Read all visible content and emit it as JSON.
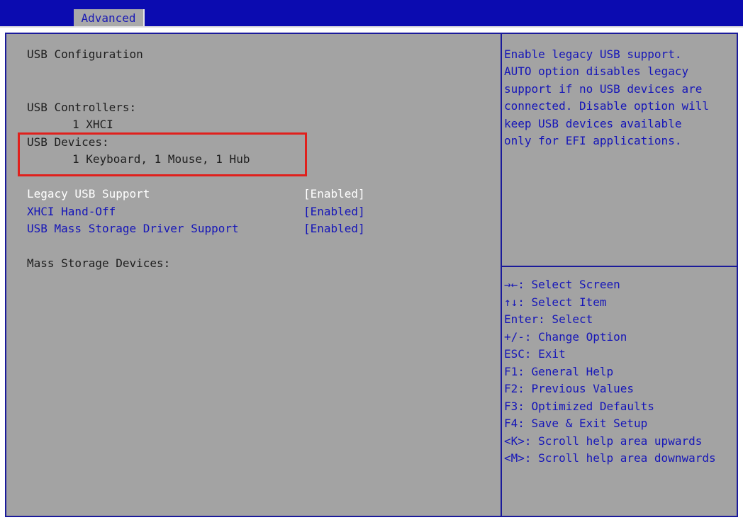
{
  "tabs": {
    "active": "Advanced"
  },
  "left": {
    "section_title": "USB Configuration",
    "controllers_label": "USB Controllers:",
    "controllers_value": "1 XHCI",
    "devices_label": "USB Devices:",
    "devices_value": "1 Keyboard, 1 Mouse, 1 Hub",
    "settings": [
      {
        "label": "Legacy USB Support",
        "value": "[Enabled]"
      },
      {
        "label": "XHCI Hand-Off",
        "value": "[Enabled]"
      },
      {
        "label": "USB Mass Storage Driver Support",
        "value": "[Enabled]"
      }
    ],
    "mass_storage_label": "Mass Storage Devices:"
  },
  "help": [
    "Enable legacy USB support.",
    "AUTO option disables legacy",
    "support if no USB devices are",
    "connected. Disable option will",
    "keep USB devices available",
    "only for EFI applications."
  ],
  "keys": [
    "→←: Select Screen",
    "↑↓: Select Item",
    "Enter: Select",
    "+/-: Change Option",
    "ESC: Exit",
    "F1: General Help",
    "F2: Previous Values",
    "F3: Optimized Defaults",
    "F4: Save & Exit Setup",
    "<K>: Scroll help area upwards",
    "<M>: Scroll help area downwards"
  ],
  "colors": {
    "header_bg": "#0b0bb0",
    "panel_bg": "#a3a3a3",
    "text_dark": "#1e1e1e",
    "text_blue": "#1515b8",
    "highlight_border": "#e0201c"
  }
}
